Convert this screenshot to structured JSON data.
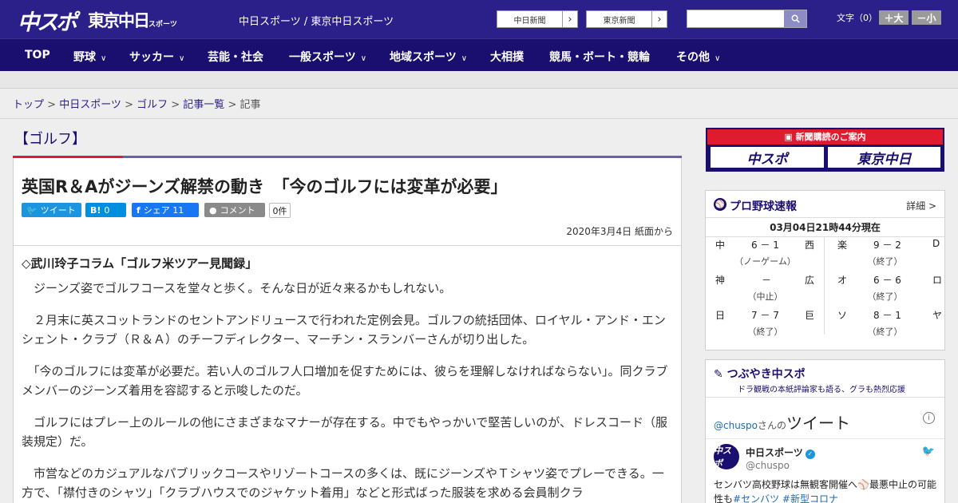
{
  "header": {
    "logo_primary": "中スポ",
    "logo_secondary": "東京中日",
    "logo_secondary_small": "スポーツ",
    "site_links": "中日スポーツ / 東京中日スポーツ",
    "paper_buttons": [
      "中日新聞",
      "東京新聞"
    ],
    "font_size_label": "文字（0）",
    "font_bigger": "＋大",
    "font_smaller": "－小"
  },
  "nav": {
    "items": [
      {
        "label": "TOP",
        "dropdown": false
      },
      {
        "label": "野球",
        "dropdown": true
      },
      {
        "label": "サッカー",
        "dropdown": true
      },
      {
        "label": "芸能・社会",
        "dropdown": false
      },
      {
        "label": "一般スポーツ",
        "dropdown": true
      },
      {
        "label": "地域スポーツ",
        "dropdown": true
      },
      {
        "label": "大相撲",
        "dropdown": false
      },
      {
        "label": "競馬・ボート・競輪",
        "dropdown": false
      },
      {
        "label": "その他",
        "dropdown": true
      }
    ]
  },
  "breadcrumb": {
    "items": [
      "トップ",
      "中日スポーツ",
      "ゴルフ",
      "記事一覧"
    ],
    "current": "記事"
  },
  "article": {
    "section": "【ゴルフ】",
    "headline": "英国R＆Aがジーンズ解禁の動き　「今のゴルフには変革が必要」",
    "share": {
      "tweet": "ツイート",
      "hatena_count": "0",
      "facebook": "シェア 11",
      "comment": "コメント",
      "comment_count": "0件"
    },
    "date": "2020年3月4日 紙面から",
    "lead": "◇武川玲子コラム「ゴルフ米ツアー見聞録」",
    "paragraphs": [
      "　ジーンズ姿でゴルフコースを堂々と歩く。そんな日が近々来るかもしれない。",
      "　２月末に英スコットランドのセントアンドリュースで行われた定例会見。ゴルフの統括団体、ロイヤル・アンド・エンシェント・クラブ（Ｒ＆Ａ）のチーフディレクター、マーチン・スランバーさんが切り出した。",
      "　「今のゴルフには変革が必要だ。若い人のゴルフ人口増加を促すためには、彼らを理解しなければならない」。同クラブメンバーのジーンズ着用を容認すると示唆したのだ。",
      "　ゴルフにはプレー上のルールの他にさまざまなマナーが存在する。中でもやっかいで堅苦しいのが、ドレスコード（服装規定）だ。",
      "　市営などのカジュアルなパブリックコースやリゾートコースの多くは、既にジーンズやＴシャツ姿でプレーできる。一方で、「襟付きのシャツ」「クラブハウスでのジャケット着用」などと形式ばった服装を求める会員制クラ"
    ]
  },
  "sidebar": {
    "ad": {
      "title": "新聞購読のご案内",
      "logo1": "中スポ",
      "logo2": "東京中日"
    },
    "baseball": {
      "title": "プロ野球速報",
      "more": "詳細 >",
      "as_of": "03月04日21時44分現在",
      "games_left": [
        {
          "home": "中",
          "score": "6 － 1",
          "away": "西",
          "status": "（ノーゲーム）"
        },
        {
          "home": "神",
          "score": "－",
          "away": "広",
          "status": "（中止）"
        },
        {
          "home": "日",
          "score": "7 － 7",
          "away": "巨",
          "status": "（終了）"
        }
      ],
      "games_right": [
        {
          "home": "楽",
          "score": "9 － 2",
          "away": "D",
          "status": "（終了）"
        },
        {
          "home": "オ",
          "score": "6 － 6",
          "away": "ロ",
          "status": "（終了）"
        },
        {
          "home": "ソ",
          "score": "8 － 1",
          "away": "ヤ",
          "status": "（終了）"
        }
      ]
    },
    "twitter": {
      "title": "つぶやき中スポ",
      "subtitle": "ドラ観戦の本紙評論家も語る、グラも熱烈応援",
      "handle_link": "@chuspo",
      "handle_suffix": "さんの",
      "tweet_word": "ツイート",
      "user_name": "中日スポーツ",
      "user_handle": "@chuspo",
      "avatar_text": "中スポ",
      "tweet_text": "センバツ高校野球は無観客開催へ⚾最悪中止の可能性も",
      "hashtags": "#センバツ #新型コロナ"
    }
  },
  "colors": {
    "header_bg": "#2b1f8a",
    "nav_bg": "#1a0f6e",
    "accent_red": "#e01a2f",
    "twitter_blue": "#1b95e0",
    "hatena_blue": "#008fde",
    "facebook_blue": "#1877f2",
    "comment_gray": "#8a8a8a"
  }
}
